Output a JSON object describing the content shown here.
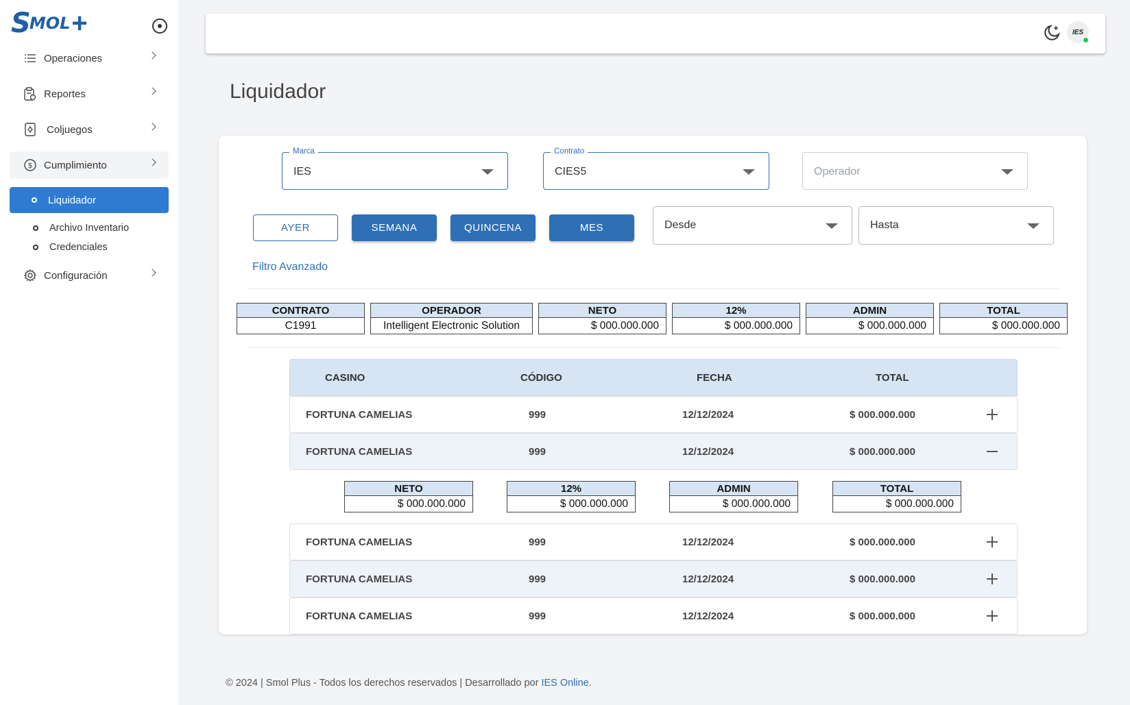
{
  "brand": {
    "logo_s": "S",
    "logo_rest": "MOL",
    "logo_plus": "+"
  },
  "sidebar": {
    "items": [
      {
        "label": "Operaciones",
        "icon": "list-icon"
      },
      {
        "label": "Reportes",
        "icon": "report-icon"
      },
      {
        "label": "Coljuegos",
        "icon": "card-icon"
      },
      {
        "label": "Cumplimiento",
        "icon": "dollar-icon"
      },
      {
        "label": "Configuración",
        "icon": "gear-icon"
      }
    ],
    "subitems": [
      {
        "label": "Liquidador",
        "active": true
      },
      {
        "label": "Archivo Inventario"
      },
      {
        "label": "Credenciales"
      }
    ]
  },
  "header": {
    "avatar_text": "IES"
  },
  "page": {
    "title": "Liquidador"
  },
  "filters": {
    "marca": {
      "legend": "Marca",
      "value": "IES"
    },
    "contrato": {
      "legend": "Contrato",
      "value": "CIES5"
    },
    "operador": {
      "placeholder": "Operador"
    },
    "desde": {
      "value": "Desde"
    },
    "hasta": {
      "value": "Hasta"
    },
    "buttons": [
      "AYER",
      "SEMANA",
      "QUINCENA",
      "MES"
    ],
    "advanced": "Filtro Avanzado"
  },
  "summary": [
    {
      "header": "CONTRATO",
      "value": "C1991"
    },
    {
      "header": "OPERADOR",
      "value": "Intelligent Electronic Solution"
    },
    {
      "header": "NETO",
      "value": "$ 000.000.000"
    },
    {
      "header": "12%",
      "value": "$ 000.000.000"
    },
    {
      "header": "ADMIN",
      "value": "$ 000.000.000"
    },
    {
      "header": "TOTAL",
      "value": "$ 000.000.000"
    }
  ],
  "table": {
    "columns": [
      "CASINO",
      "CÓDIGO",
      "FECHA",
      "TOTAL"
    ],
    "rows": [
      {
        "casino": "FORTUNA CAMELIAS",
        "codigo": "999",
        "fecha": "12/12/2024",
        "total": "$ 000.000.000"
      },
      {
        "casino": "FORTUNA CAMELIAS",
        "codigo": "999",
        "fecha": "12/12/2024",
        "total": "$ 000.000.000"
      },
      {
        "casino": "FORTUNA CAMELIAS",
        "codigo": "999",
        "fecha": "12/12/2024",
        "total": "$ 000.000.000"
      },
      {
        "casino": "FORTUNA CAMELIAS",
        "codigo": "999",
        "fecha": "12/12/2024",
        "total": "$ 000.000.000"
      },
      {
        "casino": "FORTUNA CAMELIAS",
        "codigo": "999",
        "fecha": "12/12/2024",
        "total": "$ 000.000.000"
      }
    ],
    "detail": [
      {
        "header": "NETO",
        "value": "$ 000.000.000"
      },
      {
        "header": "12%",
        "value": "$ 000.000.000"
      },
      {
        "header": "ADMIN",
        "value": "$ 000.000.000"
      },
      {
        "header": "TOTAL",
        "value": "$ 000.000.000"
      }
    ]
  },
  "footer": {
    "text": "© 2024 | Smol Plus - Todos los derechos reservados | Desarrollado por ",
    "link": "IES Online",
    "end": "."
  },
  "colors": {
    "accent": "#2f6fb6",
    "active": "#2f7bd1",
    "header_fill": "#d6e4f3"
  }
}
